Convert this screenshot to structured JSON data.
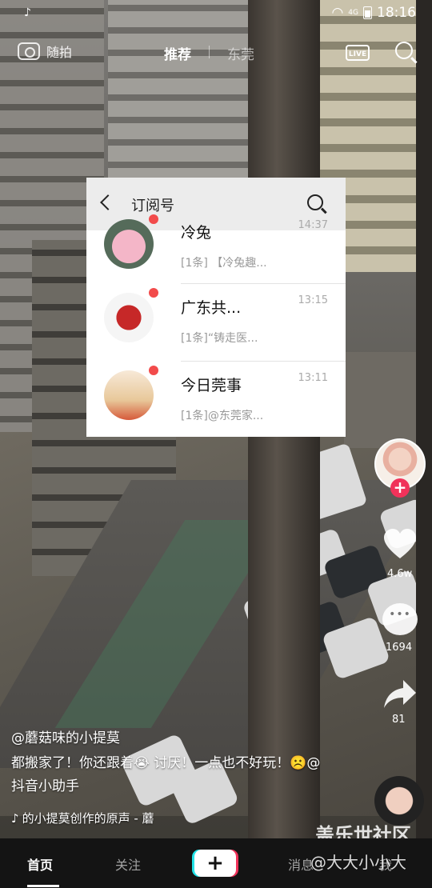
{
  "status_bar": {
    "time": "18:16",
    "network": "4G"
  },
  "top_nav": {
    "camera_label": "随拍",
    "tabs": [
      {
        "label": "推荐",
        "active": true
      },
      {
        "label": "东莞",
        "active": false
      }
    ],
    "live_label": "LIVE"
  },
  "panel": {
    "title": "订阅号",
    "items": [
      {
        "name": "冷兔",
        "time": "14:37",
        "preview": "[1条] 【冷兔趣...",
        "unread": true
      },
      {
        "name": "广东共...",
        "time": "13:15",
        "preview": "[1条]“铸走医...",
        "unread": true
      },
      {
        "name": "今日莞事",
        "time": "13:11",
        "preview": "[1条]@东莞家...",
        "unread": true
      }
    ]
  },
  "actions": {
    "follow_plus": "+",
    "like_count": "4.6w",
    "comment_count": "1694",
    "share_count": "81"
  },
  "caption": {
    "author": "@蘑菇味的小提莫",
    "description": "都搬家了！你还跟着😭 讨厌！一点也不好玩！☹️@抖音小助手",
    "music": "的小提莫创作的原声 - 蘑"
  },
  "watermark": {
    "line1": "盖乐世社区",
    "line2": "@大大小小大"
  },
  "bottom_nav": {
    "home": "首页",
    "follow": "关注",
    "plus": "+",
    "messages": "消息",
    "me": "我"
  },
  "colors": {
    "accent_red": "#f0325a",
    "accent_cyan": "#21e3e8",
    "unread_dot": "#f24b4b"
  }
}
